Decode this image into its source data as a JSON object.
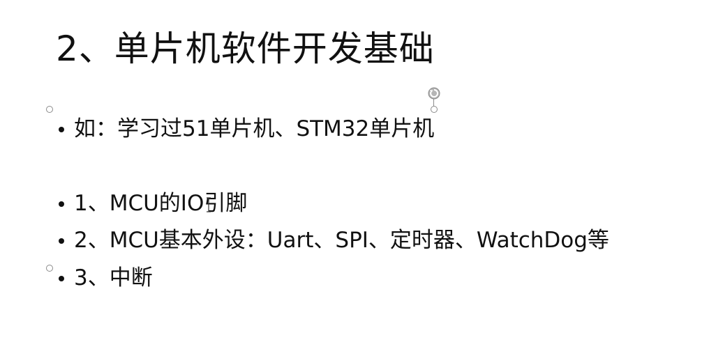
{
  "slide": {
    "title": "2、单片机软件开发基础",
    "bullets": [
      "如：学习过51单片机、STM32单片机",
      "1、MCU的IO引脚",
      "2、MCU基本外设：Uart、SPI、定时器、WatchDog等",
      "3、中断"
    ]
  },
  "icons": {
    "rotate_handle": "rotate-handle-icon",
    "resize_handle": "resize-handle-icon",
    "text_cursor": "text-cursor-icon"
  },
  "colors": {
    "background": "#ffffff",
    "text": "#111111",
    "handle": "#8a8a8a"
  }
}
